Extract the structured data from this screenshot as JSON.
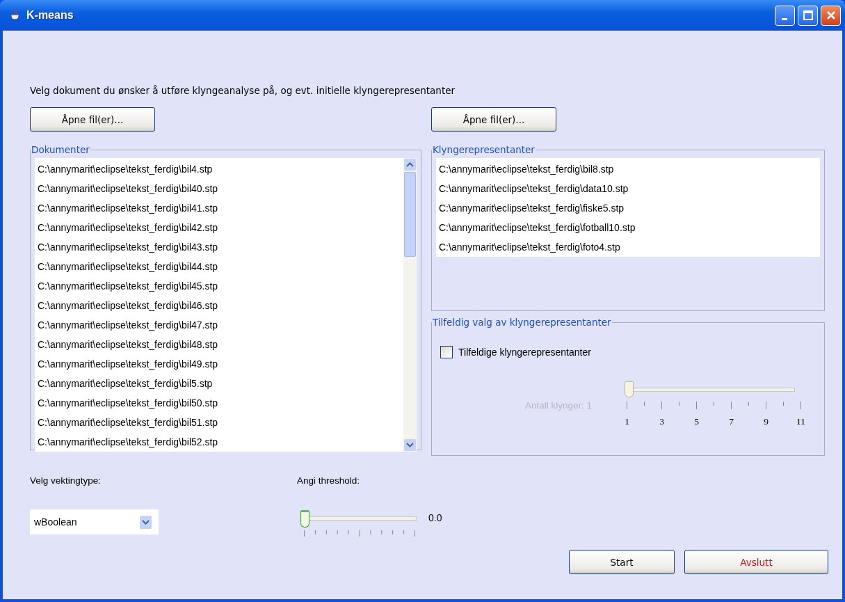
{
  "window": {
    "title": "K-means"
  },
  "instruction": "Velg dokument du ønsker å utføre klyngeanalyse på, og evt. initielle klyngerepresentanter",
  "documents": {
    "open_button": "Åpne fil(er)...",
    "title": "Dokumenter",
    "files": [
      "C:\\annymarit\\eclipse\\tekst_ferdig\\bil4.stp",
      "C:\\annymarit\\eclipse\\tekst_ferdig\\bil40.stp",
      "C:\\annymarit\\eclipse\\tekst_ferdig\\bil41.stp",
      "C:\\annymarit\\eclipse\\tekst_ferdig\\bil42.stp",
      "C:\\annymarit\\eclipse\\tekst_ferdig\\bil43.stp",
      "C:\\annymarit\\eclipse\\tekst_ferdig\\bil44.stp",
      "C:\\annymarit\\eclipse\\tekst_ferdig\\bil45.stp",
      "C:\\annymarit\\eclipse\\tekst_ferdig\\bil46.stp",
      "C:\\annymarit\\eclipse\\tekst_ferdig\\bil47.stp",
      "C:\\annymarit\\eclipse\\tekst_ferdig\\bil48.stp",
      "C:\\annymarit\\eclipse\\tekst_ferdig\\bil49.stp",
      "C:\\annymarit\\eclipse\\tekst_ferdig\\bil5.stp",
      "C:\\annymarit\\eclipse\\tekst_ferdig\\bil50.stp",
      "C:\\annymarit\\eclipse\\tekst_ferdig\\bil51.stp",
      "C:\\annymarit\\eclipse\\tekst_ferdig\\bil52.stp"
    ]
  },
  "representatives": {
    "open_button": "Åpne fil(er)...",
    "title": "Klyngerepresentanter",
    "files": [
      "C:\\annymarit\\eclipse\\tekst_ferdig\\bil8.stp",
      "C:\\annymarit\\eclipse\\tekst_ferdig\\data10.stp",
      "C:\\annymarit\\eclipse\\tekst_ferdig\\fiske5.stp",
      "C:\\annymarit\\eclipse\\tekst_ferdig\\fotball10.stp",
      "C:\\annymarit\\eclipse\\tekst_ferdig\\foto4.stp"
    ]
  },
  "random": {
    "title": "Tilfeldig valg av klyngerepresentanter",
    "checkbox": {
      "label": "Tilfeldige klyngerepresentanter",
      "checked": false
    },
    "count": {
      "label": "Antall klynger: 1",
      "disabled": true,
      "level": 0,
      "tick_labels": [
        "1",
        "3",
        "5",
        "7",
        "9",
        "11"
      ]
    }
  },
  "weighting": {
    "label": "Velg vektingtype:",
    "value": "wBoolean"
  },
  "threshold": {
    "label": "Angi threshold:",
    "level": 0,
    "reading": "0.0"
  },
  "buttons": [
    {
      "label": "Start",
      "kind": "normal"
    },
    {
      "label": "Avslutt",
      "kind": "danger"
    }
  ]
}
